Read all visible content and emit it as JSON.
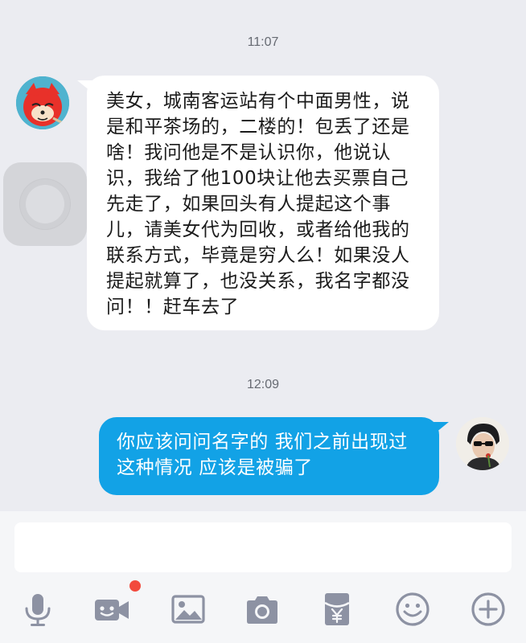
{
  "chat": {
    "messages": [
      {
        "timestamp": "11:07",
        "direction": "incoming",
        "text": "美女，城南客运站有个中面男性，说是和平茶场的，二楼的！包丢了还是啥！我问他是不是认识你，他说认识，我给了他100块让他去买票自己先走了，如果回头有人提起这个事儿，请美女代为回收，或者给他我的联系方式，毕竟是穷人么！如果没人提起就算了，也没关系，我名字都没问！！赶车去了"
      },
      {
        "timestamp": "12:09",
        "direction": "outgoing",
        "text": "你应该问问名字的 我们之前出现过这种情况 应该是被骗了"
      }
    ]
  },
  "input": {
    "value": "",
    "placeholder": ""
  },
  "toolbar": {
    "icons": [
      "mic-icon",
      "video-icon",
      "image-icon",
      "camera-icon",
      "red-packet-icon",
      "emoji-icon",
      "plus-icon"
    ],
    "video_has_badge": true
  },
  "colors": {
    "chat_background": "#ebecf1",
    "incoming_bubble": "#ffffff",
    "outgoing_bubble": "#12a2e6",
    "icon": "#8d92a3",
    "badge": "#f24a3d"
  }
}
